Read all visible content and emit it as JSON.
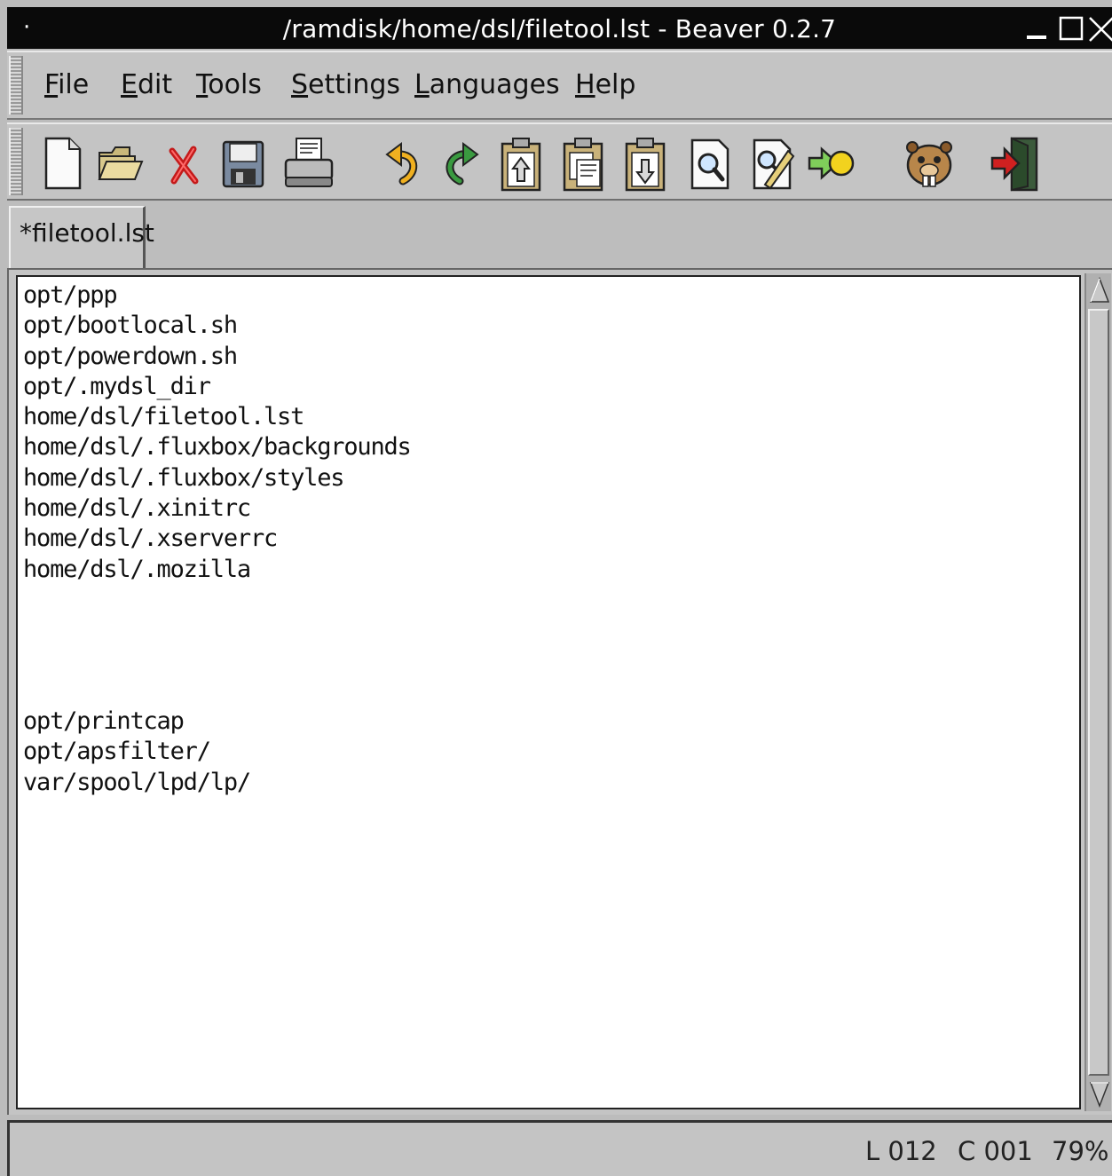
{
  "window": {
    "title": "/ramdisk/home/dsl/filetool.lst - Beaver 0.2.7",
    "system_menu_glyph": "·"
  },
  "menubar": {
    "items": [
      {
        "label": "File",
        "mnemonic": "F"
      },
      {
        "label": "Edit",
        "mnemonic": "E"
      },
      {
        "label": "Tools",
        "mnemonic": "T"
      },
      {
        "label": "Settings",
        "mnemonic": "S"
      },
      {
        "label": "Languages",
        "mnemonic": "L"
      },
      {
        "label": "Help",
        "mnemonic": "H"
      }
    ]
  },
  "toolbar": {
    "buttons": [
      {
        "icon": "new-file-icon"
      },
      {
        "icon": "open-folder-icon"
      },
      {
        "icon": "close-file-icon"
      },
      {
        "icon": "save-icon"
      },
      {
        "icon": "print-icon"
      },
      {
        "icon": "undo-icon"
      },
      {
        "icon": "redo-icon"
      },
      {
        "icon": "cut-icon"
      },
      {
        "icon": "copy-icon"
      },
      {
        "icon": "paste-icon"
      },
      {
        "icon": "find-icon"
      },
      {
        "icon": "replace-icon"
      },
      {
        "icon": "goto-line-icon"
      },
      {
        "icon": "beaver-about-icon"
      },
      {
        "icon": "exit-icon"
      }
    ]
  },
  "tabs": [
    {
      "label": "*filetool.lst",
      "active": true
    }
  ],
  "editor": {
    "lines": [
      "opt/ppp",
      "opt/bootlocal.sh",
      "opt/powerdown.sh",
      "opt/.mydsl_dir",
      "home/dsl/filetool.lst",
      "home/dsl/.fluxbox/backgrounds",
      "home/dsl/.fluxbox/styles",
      "home/dsl/.xinitrc",
      "home/dsl/.xserverrc",
      "home/dsl/.mozilla",
      "",
      "",
      "",
      "",
      "opt/printcap",
      "opt/apsfilter/",
      "var/spool/lpd/lp/"
    ]
  },
  "statusbar": {
    "line": "L 012",
    "column": "C 001",
    "percent": "79%"
  },
  "colors": {
    "titlebar_bg": "#0a0a0a",
    "chrome_bg": "#c4c4c4",
    "editor_bg": "#ffffff"
  }
}
